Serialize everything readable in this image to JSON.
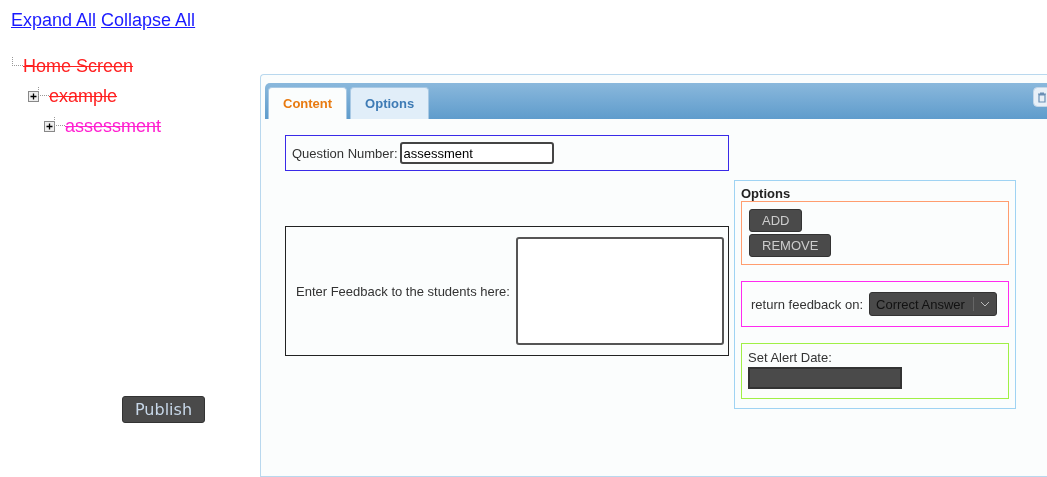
{
  "links": [
    "Expand All",
    "Collapse All"
  ],
  "tree": [
    {
      "label": "Home Screen",
      "color": "#ff2020",
      "has_toggle": false,
      "children": [
        {
          "label": "example",
          "color": "#ff2020",
          "has_toggle": true,
          "children": [
            {
              "label": "assessment",
              "color": "#ff20d0",
              "has_toggle": true
            }
          ]
        }
      ]
    }
  ],
  "publish_button": "Publish",
  "tabs": [
    {
      "label": "Content",
      "selected": true
    },
    {
      "label": "Options",
      "selected": false
    }
  ],
  "question_number": {
    "label": "Question Number:",
    "value": "assessment"
  },
  "feedback": {
    "label": "Enter Feedback to the students here:"
  },
  "options": {
    "title": "Options",
    "buttons": [
      "ADD",
      "REMOVE"
    ],
    "return_label": "return feedback on:",
    "return_value": "Correct Answer",
    "alert_label": "Set Alert Date:"
  }
}
